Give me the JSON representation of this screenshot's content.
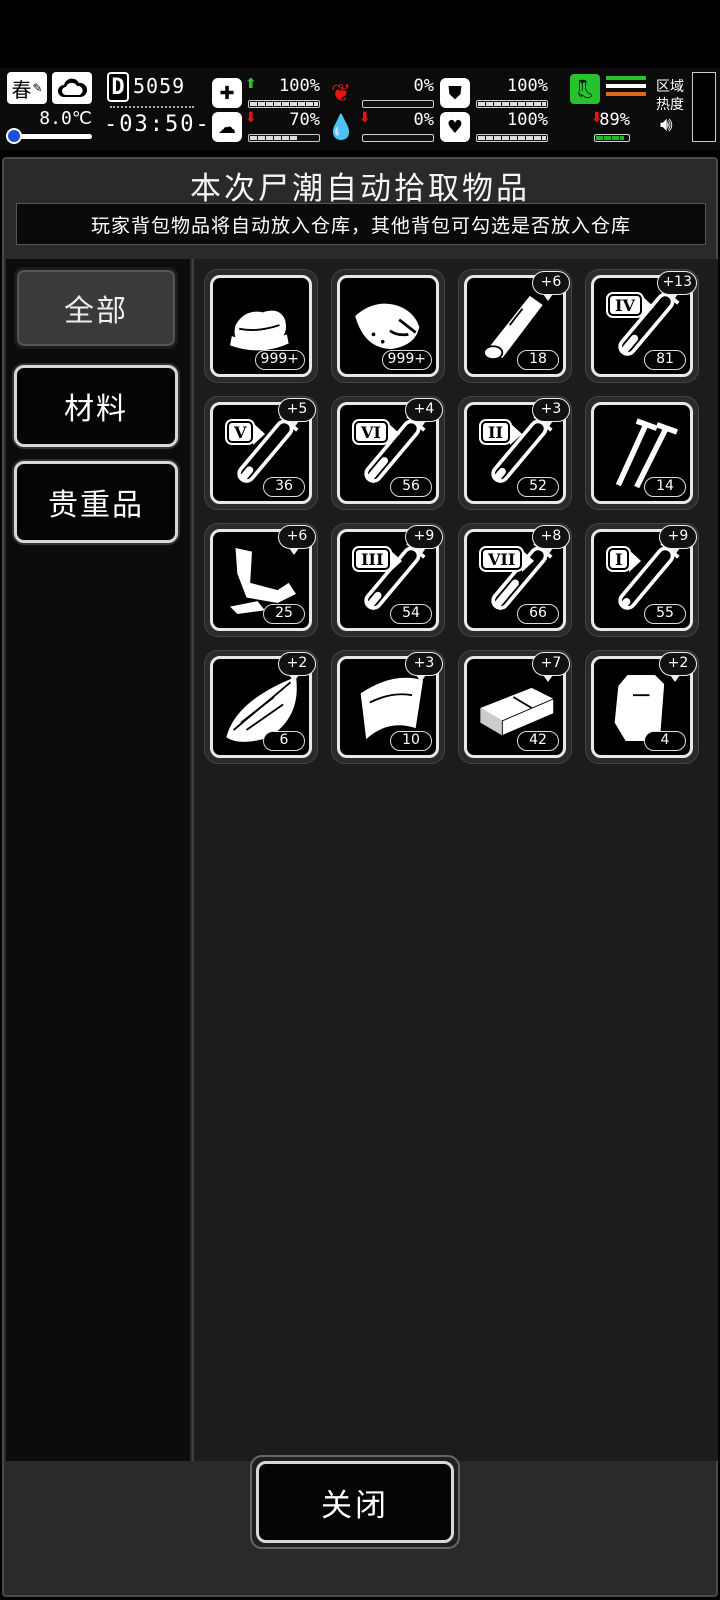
{
  "status": {
    "season": "春",
    "temperature": "8.0℃",
    "day_prefix": "D",
    "day": "5059",
    "clock": "-03:50-",
    "stats": [
      {
        "id": "health",
        "icon": "medkit-icon",
        "glyph": "✚",
        "trend": "up",
        "value": "100%",
        "level": 1.0
      },
      {
        "id": "hunger",
        "icon": "stomach-icon",
        "glyph": "❦",
        "trend": "",
        "value": "0%",
        "level": 0.0
      },
      {
        "id": "armor",
        "icon": "shield-icon",
        "glyph": "⛊",
        "trend": "",
        "value": "100%",
        "level": 1.0
      },
      {
        "id": "mood",
        "icon": "brain-icon",
        "glyph": "☁",
        "trend": "down",
        "value": "70%",
        "level": 0.7
      },
      {
        "id": "bleeding",
        "icon": "blood-drop-icon",
        "glyph": "💧",
        "trend": "down",
        "value": "0%",
        "level": 0.0
      },
      {
        "id": "heart",
        "icon": "heart-icon",
        "glyph": "♥",
        "trend": "",
        "value": "100%",
        "level": 1.0
      },
      {
        "id": "stamina",
        "icon": "stamina-icon",
        "glyph": "",
        "trend": "down",
        "value": "89%",
        "level": 0.89
      }
    ],
    "region_label": "区域\n热度",
    "colors": {
      "stamina_green": "#27c22e",
      "temp_blue": "#1c4ed8",
      "alert_red": "#e11111",
      "stripe_orange": "#e0661a"
    }
  },
  "panel": {
    "title": "本次尸潮自动拾取物品",
    "subtitle": "玩家背包物品将自动放入仓库，其他背包可勾选是否放入仓库"
  },
  "tabs": [
    {
      "label": "全部",
      "active": true
    },
    {
      "label": "材料",
      "active": false
    },
    {
      "label": "贵重品",
      "active": false
    }
  ],
  "items": [
    {
      "icon": "cloth-icon",
      "count": "999+",
      "plus": "",
      "tier": ""
    },
    {
      "icon": "meat-icon",
      "count": "999+",
      "plus": "",
      "tier": ""
    },
    {
      "icon": "wood-log-icon",
      "count": "18",
      "plus": "+6",
      "tier": ""
    },
    {
      "icon": "potion-tube-icon",
      "count": "81",
      "plus": "+13",
      "tier": "IV",
      "fill": 0.45
    },
    {
      "icon": "potion-tube-icon",
      "count": "36",
      "plus": "+5",
      "tier": "V",
      "fill": 0.3
    },
    {
      "icon": "potion-tube-icon",
      "count": "56",
      "plus": "+4",
      "tier": "VI",
      "fill": 0.6
    },
    {
      "icon": "potion-tube-icon",
      "count": "52",
      "plus": "+3",
      "tier": "II",
      "fill": 0.25
    },
    {
      "icon": "nails-icon",
      "count": "14",
      "plus": "",
      "tier": ""
    },
    {
      "icon": "scrap-metal-icon",
      "count": "25",
      "plus": "+6",
      "tier": ""
    },
    {
      "icon": "potion-tube-icon",
      "count": "54",
      "plus": "+9",
      "tier": "III",
      "fill": 0.35
    },
    {
      "icon": "potion-tube-icon",
      "count": "66",
      "plus": "+8",
      "tier": "VII",
      "fill": 0.75
    },
    {
      "icon": "potion-tube-icon",
      "count": "55",
      "plus": "+9",
      "tier": "I",
      "fill": 0.15
    },
    {
      "icon": "herb-leaf-icon",
      "count": "6",
      "plus": "+2",
      "tier": ""
    },
    {
      "icon": "leather-icon",
      "count": "10",
      "plus": "+3",
      "tier": ""
    },
    {
      "icon": "brick-icon",
      "count": "42",
      "plus": "+7",
      "tier": ""
    },
    {
      "icon": "plastic-bag-icon",
      "count": "4",
      "plus": "+2",
      "tier": ""
    }
  ],
  "footer": {
    "close_label": "关闭"
  }
}
